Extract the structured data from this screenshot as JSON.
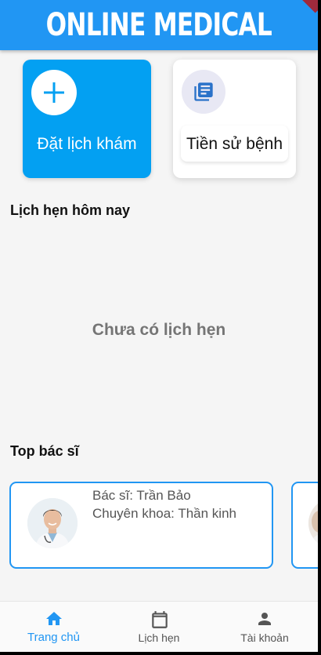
{
  "header": {
    "title": "ONLINE MEDICAL",
    "color": "#2196f3"
  },
  "actions": {
    "book": {
      "label": "Đặt lịch khám",
      "icon": "plus-icon",
      "color": "#03a0f2"
    },
    "history": {
      "label": "Tiền sử bệnh",
      "icon": "document-list-icon"
    }
  },
  "today": {
    "title": "Lịch hẹn hôm nay",
    "empty_text": "Chưa có lịch hẹn"
  },
  "top_doctors": {
    "title": "Top bác sĩ",
    "items": [
      {
        "name": "Bác sĩ: Trần Bảo",
        "specialty": "Chuyên khoa: Thần kinh",
        "icon": "doctor-photo"
      },
      {
        "name": "",
        "specialty": "",
        "icon": "doctor-photo"
      }
    ]
  },
  "bottom_nav": {
    "active_color": "#2196f3",
    "items": [
      {
        "label": "Trang chủ",
        "icon": "home-icon",
        "active": true
      },
      {
        "label": "Lịch hẹn",
        "icon": "calendar-icon",
        "active": false
      },
      {
        "label": "Tài khoản",
        "icon": "person-icon",
        "active": false
      }
    ]
  }
}
